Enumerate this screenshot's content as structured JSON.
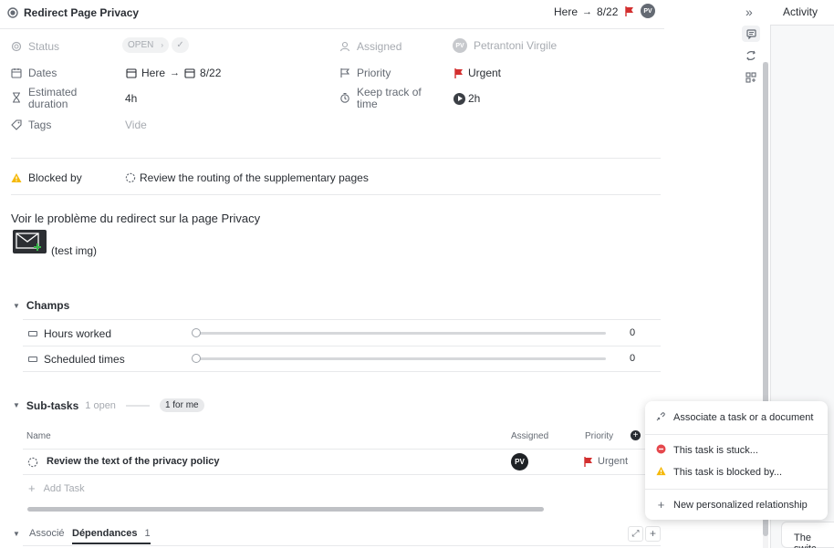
{
  "header": {
    "task_title": "Redirect Page Privacy",
    "start_label": "Here",
    "due_label": "8/22",
    "avatar_initials": "PV",
    "collapse_icon": "double-chevron-right"
  },
  "fields": {
    "status_label": "Status",
    "status_value": "OPEN",
    "assigned_label": "Assigned",
    "assignee_initials": "PV",
    "assignee_name": "Petrantoni Virgile",
    "dates_label": "Dates",
    "dates_start": "Here",
    "dates_end": "8/22",
    "priority_label": "Priority",
    "priority_value": "Urgent",
    "estimated_label_1": "Estimated",
    "estimated_label_2": "duration",
    "estimated_value": "4h",
    "tracking_label_1": "Keep track of",
    "tracking_label_2": "time",
    "tracking_value": "2h",
    "tags_label": "Tags",
    "tags_value": "Vide"
  },
  "blocked": {
    "label": "Blocked by",
    "task": "Review the routing of the supplementary pages"
  },
  "description": {
    "text": "Voir le problème du redirect sur la page Privacy",
    "image_caption": "(test img)"
  },
  "champs": {
    "title": "Champs",
    "rows": [
      {
        "label": "Hours worked",
        "value": "0"
      },
      {
        "label": "Scheduled times",
        "value": "0"
      }
    ]
  },
  "subtasks": {
    "title": "Sub-tasks",
    "open_count": "1 open",
    "for_me": "1 for me",
    "col_name": "Name",
    "col_assigned": "Assigned",
    "col_priority": "Priority",
    "rows": [
      {
        "name": "Review the text of the privacy policy",
        "assignee": "PV",
        "priority": "Urgent"
      }
    ],
    "add_task": "Add Task"
  },
  "bottom_tabs": {
    "associe": "Associé",
    "dependances": "Dépendances",
    "dependances_count": "1"
  },
  "menu": {
    "items": [
      "Associate a task or a document",
      "This task is stuck...",
      "This task is blocked by...",
      "New personalized relationship"
    ]
  },
  "activity": {
    "title": "Activity",
    "partial_text": "The switc"
  },
  "colors": {
    "urgent": "#d32f2f",
    "warning": "#f5b90b",
    "stuck": "#e5484d",
    "tag_bg": "#e8e9eb"
  }
}
